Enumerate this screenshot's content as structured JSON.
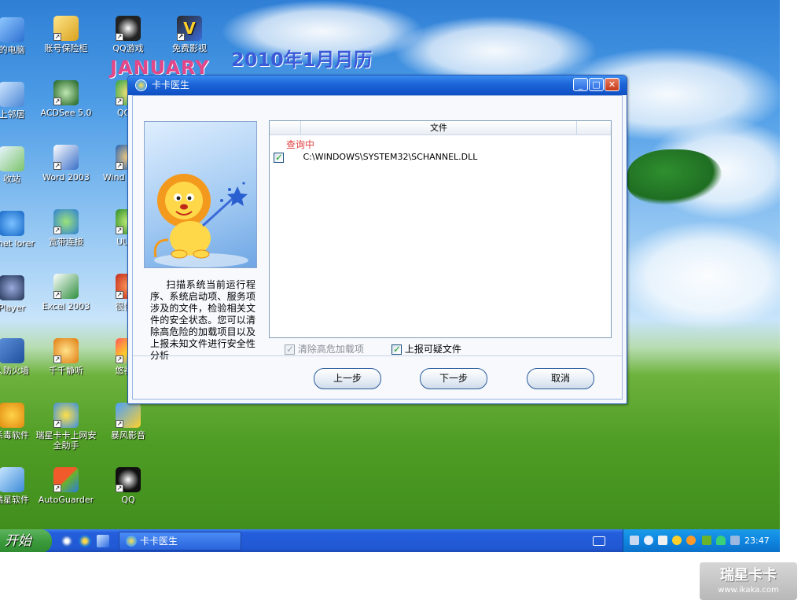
{
  "desktop": {
    "calendar_title": "2010年1月月历",
    "calendar_month": "JANUARY",
    "icons": [
      {
        "label": "的电脑"
      },
      {
        "label": "账号保险柜"
      },
      {
        "label": "QQ游戏"
      },
      {
        "label": "免费影视"
      },
      {
        "label": "上邻居"
      },
      {
        "label": "ACDSee 5.0"
      },
      {
        "label": "QQ音"
      },
      {
        "label": "收站"
      },
      {
        "label": "Word 2003"
      },
      {
        "label": "Wind Media"
      },
      {
        "label": "ernet lorer"
      },
      {
        "label": "宽带连接"
      },
      {
        "label": "UUSe"
      },
      {
        "label": "Player"
      },
      {
        "label": "Excel 2003"
      },
      {
        "label": "很快视"
      },
      {
        "label": "人防火墙"
      },
      {
        "label": "千千静听"
      },
      {
        "label": "悠视网"
      },
      {
        "label": "杀毒软件"
      },
      {
        "label": "瑞星卡卡上网安全助手"
      },
      {
        "label": "暴风影音"
      },
      {
        "label": "瑞星软件"
      },
      {
        "label": "AutoGuarder"
      },
      {
        "label": "QQ"
      }
    ]
  },
  "window": {
    "title": "卡卡医生",
    "description": "扫描系统当前运行程序、系统启动项、服务项涉及的文件，检验相关文件的安全状态。您可以清除高危险的加载项目以及上报未知文件进行安全性分析",
    "file_list": {
      "column_header": "文件",
      "status": "查询中",
      "rows": [
        {
          "checked": true,
          "path": "C:\\WINDOWS\\SYSTEM32\\SCHANNEL.DLL"
        }
      ]
    },
    "options": {
      "clear_high_risk": {
        "label": "清除高危加载项",
        "checked": true,
        "enabled": false
      },
      "report_suspicious": {
        "label": "上报可疑文件",
        "checked": true,
        "enabled": true
      }
    },
    "buttons": {
      "prev": "上一步",
      "next": "下一步",
      "cancel": "取消"
    }
  },
  "taskbar": {
    "start_label": "开始",
    "task_label": "卡卡医生",
    "clock": "23:47"
  },
  "watermark": {
    "brand": "瑞星卡卡",
    "url": "www.ikaka.com"
  },
  "colors": {
    "titlebar": "#1b64d8",
    "status_text": "#e04040",
    "start_button": "#3c9b3c",
    "taskbar": "#245edb"
  }
}
